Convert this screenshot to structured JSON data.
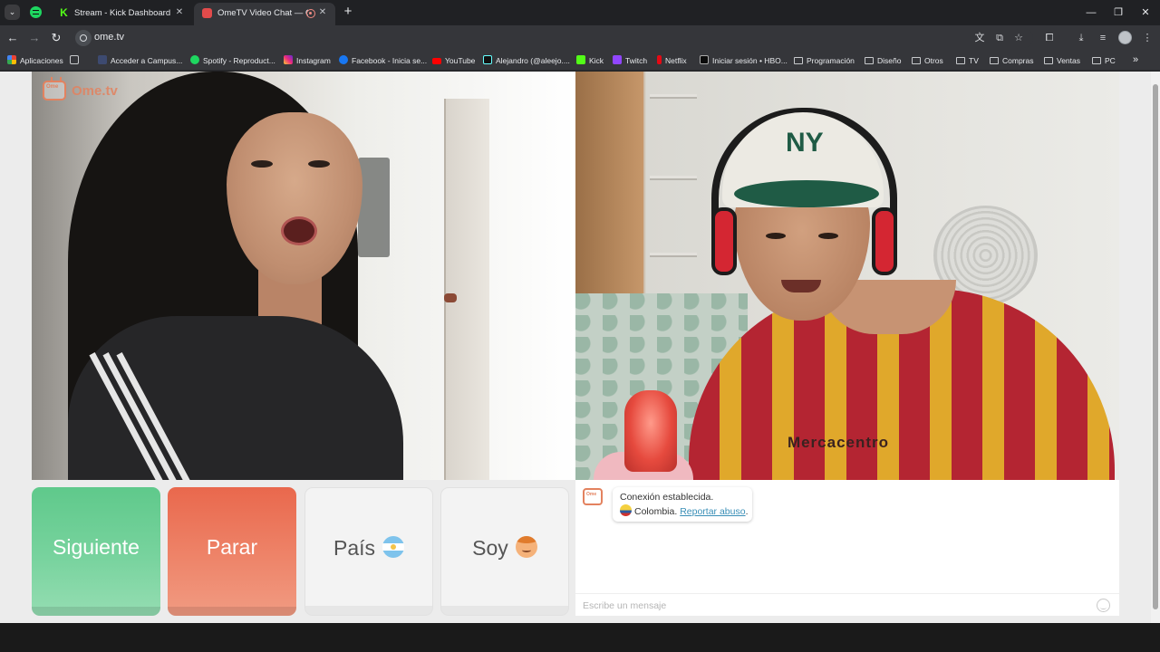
{
  "browser": {
    "tabs": [
      {
        "title": "Stream - Kick Dashboard",
        "favicon": "kick-icon"
      },
      {
        "title": "OmeTV Video Chat — Ome",
        "favicon": "ometv-icon",
        "recording": true
      }
    ],
    "url": "ome.tv",
    "bookmarks": [
      {
        "label": "Aplicaciones",
        "icon": "apps-grid-icon"
      },
      {
        "label": "Acceder a Campus...",
        "icon": "campus-icon"
      },
      {
        "label": "Spotify - Reproduct...",
        "icon": "spotify-icon"
      },
      {
        "label": "Instagram",
        "icon": "instagram-icon"
      },
      {
        "label": "Facebook - Inicia se...",
        "icon": "facebook-icon"
      },
      {
        "label": "YouTube",
        "icon": "youtube-icon"
      },
      {
        "label": "Alejandro (@aleejo....",
        "icon": "tiktok-icon"
      },
      {
        "label": "Kick",
        "icon": "kick-icon"
      },
      {
        "label": "Twitch",
        "icon": "twitch-icon"
      },
      {
        "label": "Netflix",
        "icon": "netflix-icon"
      },
      {
        "label": "Iniciar sesión • HBO...",
        "icon": "hbo-icon"
      },
      {
        "label": "Programación",
        "icon": "folder-icon"
      },
      {
        "label": "Diseño",
        "icon": "folder-icon"
      },
      {
        "label": "Otros",
        "icon": "folder-icon"
      },
      {
        "label": "TV",
        "icon": "folder-icon"
      },
      {
        "label": "Compras",
        "icon": "folder-icon"
      },
      {
        "label": "Ventas",
        "icon": "folder-icon"
      },
      {
        "label": "PC",
        "icon": "folder-icon"
      }
    ]
  },
  "app": {
    "logo_text": "Ome.tv",
    "buttons": {
      "next": "Siguiente",
      "stop": "Parar",
      "country": "País",
      "gender": "Soy"
    },
    "chat": {
      "connection_message": "Conexión establecida.",
      "country": "Colombia.",
      "report_link": "Reportar abuso",
      "report_suffix": ".",
      "input_placeholder": "Escribe un mensaje"
    },
    "video_right": {
      "cap_letters": "NY",
      "shirt_sponsor": "Mercacentro"
    }
  },
  "colors": {
    "next_button": "#5fc98b",
    "stop_button": "#e9684d",
    "brand": "#e3825f",
    "link": "#3a8fb7"
  }
}
